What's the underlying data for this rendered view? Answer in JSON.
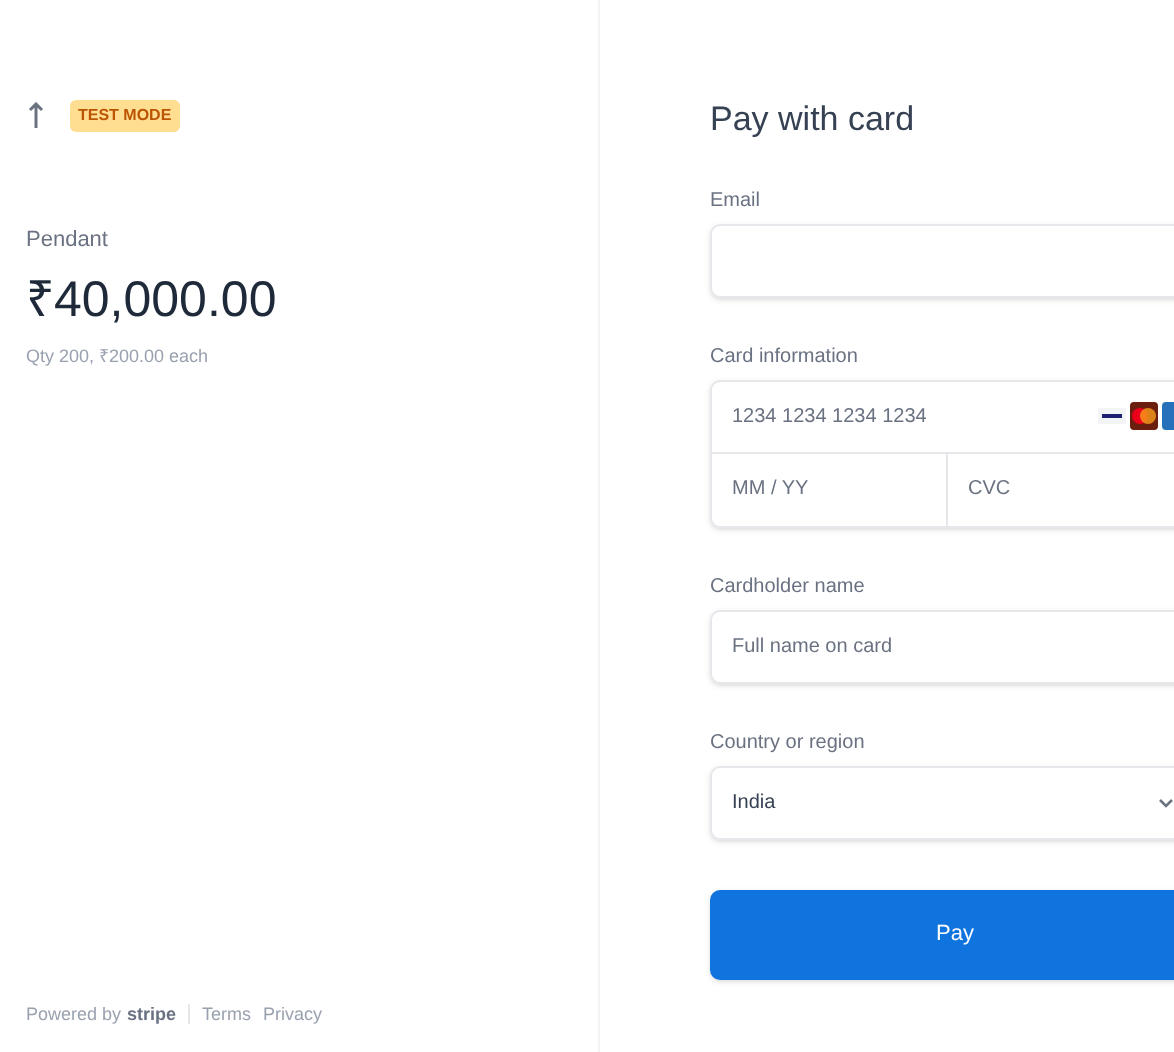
{
  "summary": {
    "badge": "TEST MODE",
    "product": "Pendant",
    "price": "₹40,000.00",
    "quantity": "Qty 200, ₹200.00 each"
  },
  "footer": {
    "powered": "Powered by",
    "brand": "stripe",
    "links": [
      "Terms",
      "Privacy"
    ]
  },
  "form": {
    "title": "Pay with card",
    "email": {
      "label": "Email"
    },
    "card": {
      "label": "Card information",
      "number_placeholder": "1234 1234 1234 1234",
      "expiry_placeholder": "MM / YY",
      "cvc_placeholder": "CVC"
    },
    "name": {
      "label": "Cardholder name",
      "placeholder": "Full name on card"
    },
    "country": {
      "label": "Country or region",
      "value": "India"
    },
    "button": "Pay"
  }
}
